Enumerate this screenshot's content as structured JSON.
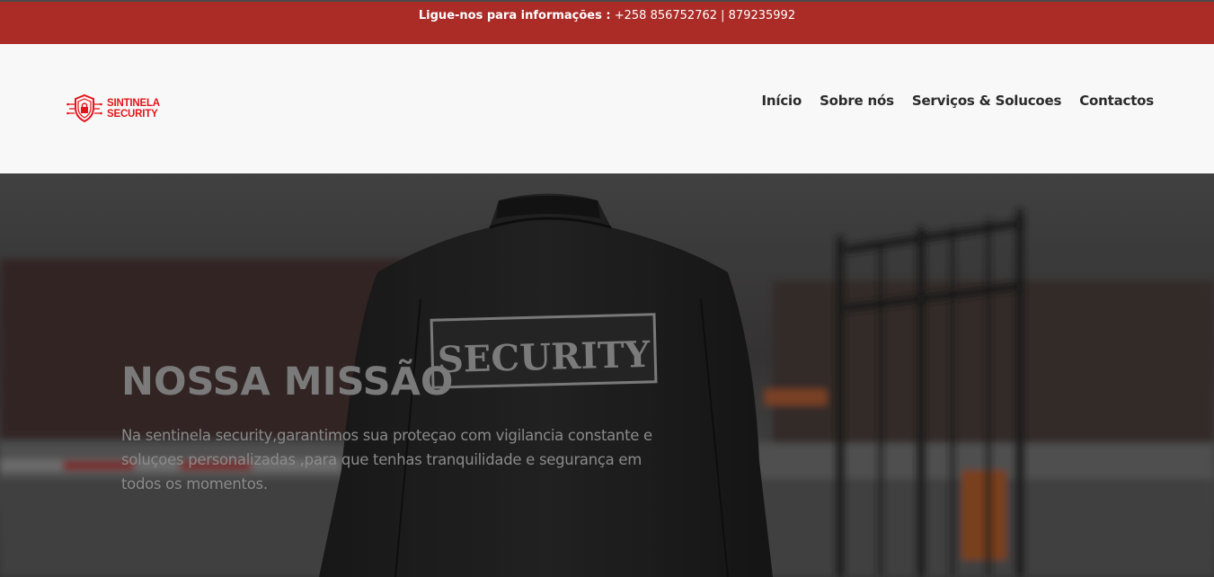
{
  "topbar": {
    "label": "Ligue-nos para informações :",
    "phones": "+258 856752762 | 879235992"
  },
  "logo": {
    "line1": "SINTINELA",
    "line2": "SECURITY",
    "icon": "shield-lock-icon"
  },
  "nav": {
    "items": [
      {
        "label": "Início"
      },
      {
        "label": "Sobre nós"
      },
      {
        "label": "Serviços & Solucoes"
      },
      {
        "label": "Contactos"
      }
    ]
  },
  "hero": {
    "title": "NOSSA MISSÃO",
    "text": "Na sentinela security,garantimos sua proteçao com vigilancia constante e soluçoes personalizadas ,para que tenhas tranquilidade e segurança em todos os momentos.",
    "patch_text": "SECURITY"
  },
  "colors": {
    "topbar": "#ab2b27",
    "brand": "#e5141a",
    "header_bg": "#f8f8f8"
  }
}
